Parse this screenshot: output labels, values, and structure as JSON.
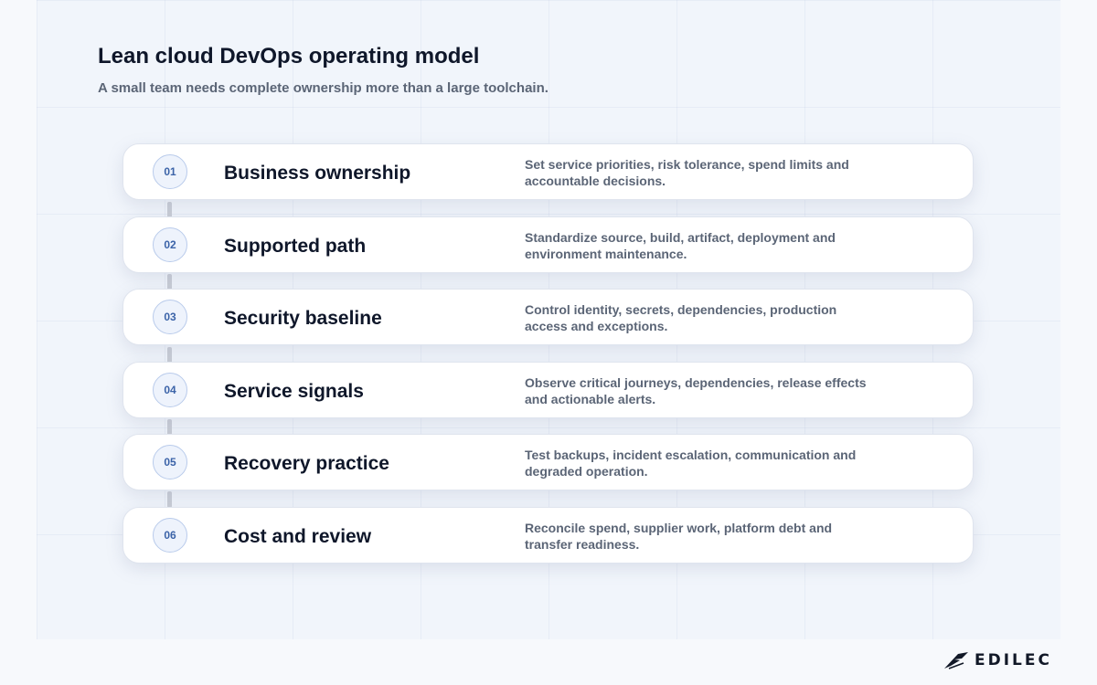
{
  "header": {
    "title": "Lean cloud DevOps operating model",
    "subtitle": "A small team needs complete ownership more than a large toolchain."
  },
  "steps": [
    {
      "number": "01",
      "title": "Business ownership",
      "description": "Set service priorities, risk tolerance, spend limits and accountable decisions."
    },
    {
      "number": "02",
      "title": "Supported path",
      "description": "Standardize source, build, artifact, deployment and environment maintenance."
    },
    {
      "number": "03",
      "title": "Security baseline",
      "description": "Control identity, secrets, dependencies, production access and exceptions."
    },
    {
      "number": "04",
      "title": "Service signals",
      "description": "Observe critical journeys, dependencies, release effects and actionable alerts."
    },
    {
      "number": "05",
      "title": "Recovery practice",
      "description": "Test backups, incident escalation, communication and degraded operation."
    },
    {
      "number": "06",
      "title": "Cost and review",
      "description": "Reconcile spend, supplier work, platform debt and transfer readiness."
    }
  ],
  "brand": {
    "name": "EDILEC",
    "icon": "edilec-logo-icon"
  },
  "colors": {
    "accent": "#3b63a8",
    "badge_border": "#b9cbeb",
    "connector": "#c9cdd6"
  }
}
